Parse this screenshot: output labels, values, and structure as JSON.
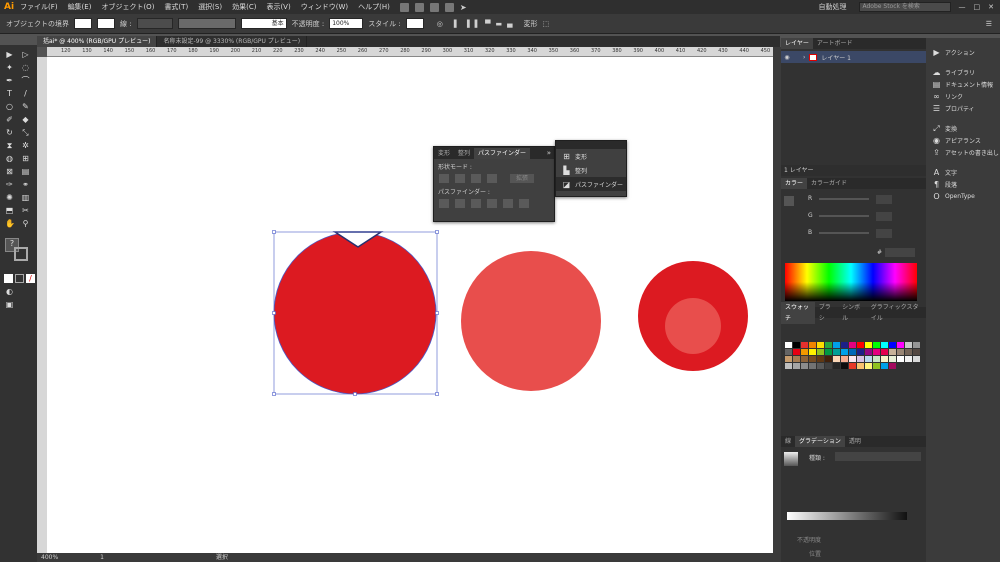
{
  "app": {
    "logo": "Ai"
  },
  "menu": {
    "items": [
      "ファイル(F)",
      "編集(E)",
      "オブジェクト(O)",
      "書式(T)",
      "選択(S)",
      "効果(C)",
      "表示(V)",
      "ウィンドウ(W)",
      "ヘルプ(H)"
    ],
    "workspace": "自動処理",
    "search_placeholder": "Adobe Stock を検索"
  },
  "control": {
    "object_state": "オブジェクトの境界",
    "stroke_label": "線 :",
    "style_basic": "基本",
    "opacity_label": "不透明度 :",
    "opacity_value": "100%",
    "style_label": "スタイル :",
    "transform_label": "変形"
  },
  "tabs": [
    {
      "label": "括ai* @ 400% (RGB/GPU プレビュー)",
      "active": true
    },
    {
      "label": "名称未設定-99 @ 3330% (RGB/GPU プレビュー)",
      "active": false
    }
  ],
  "ruler": {
    "h": [
      "120",
      "130",
      "140",
      "150",
      "160",
      "170",
      "180",
      "190",
      "200",
      "210",
      "220",
      "230",
      "240",
      "250",
      "260",
      "270",
      "280",
      "290",
      "300",
      "310",
      "320",
      "330",
      "340",
      "350",
      "360",
      "370",
      "380",
      "390",
      "400",
      "410",
      "420",
      "430",
      "440",
      "450"
    ]
  },
  "status": {
    "zoom": "400%",
    "page": "1",
    "mode": "選択"
  },
  "pathfinder": {
    "tabs": [
      "変形",
      "整列",
      "パスファインダー"
    ],
    "shape_modes": "形状モード :",
    "expand": "拡張",
    "pathfinders": "パスファインダー :"
  },
  "popup_menu": {
    "items": [
      "変形",
      "整列",
      "パスファインダー"
    ]
  },
  "layers": {
    "tabs": [
      "レイヤー",
      "アートボード"
    ],
    "layer_name": "レイヤー 1",
    "footer": "1 レイヤー"
  },
  "color": {
    "tabs": [
      "カラー",
      "カラーガイド"
    ],
    "labels": [
      "R",
      "G",
      "B"
    ],
    "hash": "#"
  },
  "swatches": {
    "tabs": [
      "スウォッチ",
      "ブラシ",
      "シンボル",
      "グラフィックスタイル"
    ],
    "colors": [
      "#ffffff",
      "#000000",
      "#e6312e",
      "#ef8400",
      "#ffdd00",
      "#2aa53e",
      "#00a0e9",
      "#1d2087",
      "#e4007f",
      "#ff0000",
      "#ffff00",
      "#00ff00",
      "#00ffff",
      "#0000ff",
      "#ff00ff",
      "#c8c8c8",
      "#969696",
      "#646464",
      "#e60012",
      "#f39800",
      "#fff100",
      "#8fc31f",
      "#009944",
      "#009e96",
      "#00a0e9",
      "#0068b7",
      "#1d2088",
      "#920783",
      "#e4007f",
      "#e5004f",
      "#c7b299",
      "#998675",
      "#736357",
      "#534741",
      "#c69c6d",
      "#a67c52",
      "#8c6239",
      "#754c24",
      "#603813",
      "#42210b",
      "#fbd7b7",
      "#f6ae91",
      "#fce8ef",
      "#d7c4e4",
      "#b9d9ef",
      "#cbe6c6",
      "#f9f3c9",
      "#e9f1d8",
      "#ffffff",
      "#f2f2f2",
      "#d9d9d9",
      "#bfbfbf",
      "#a6a6a6",
      "#8c8c8c",
      "#737373",
      "#595959",
      "#404040",
      "#262626",
      "#0d0d0d",
      "#e83828",
      "#f9c270",
      "#fff67f",
      "#8fc31f",
      "#00a0e9",
      "#a40b5e"
    ]
  },
  "gradient": {
    "tabs": [
      "線",
      "グラデーション",
      "透明"
    ],
    "type_label": "種類 :",
    "opacity_label": "不透明度",
    "location_label": "位置"
  },
  "doc_panel": {
    "items": [
      {
        "label": "アクション",
        "icon": "play-icon"
      },
      {
        "label": "ライブラリ",
        "icon": "library-icon"
      },
      {
        "label": "ドキュメント情報",
        "icon": "info-icon"
      },
      {
        "label": "リンク",
        "icon": "link-icon"
      },
      {
        "label": "プロパティ",
        "icon": "properties-icon"
      },
      {
        "label": "変換",
        "icon": "transform-icon"
      },
      {
        "label": "アピアランス",
        "icon": "appearance-icon"
      },
      {
        "label": "アセットの書き出し",
        "icon": "export-icon"
      },
      {
        "label": "文字",
        "icon": "character-icon"
      },
      {
        "label": "段落",
        "icon": "paragraph-icon"
      },
      {
        "label": "OpenType",
        "icon": "opentype-icon"
      }
    ]
  },
  "canvas": {
    "colors": {
      "deep_red": "#dc1a21",
      "light_red": "#e84e4c",
      "bounding": "#4a5ac8"
    }
  }
}
